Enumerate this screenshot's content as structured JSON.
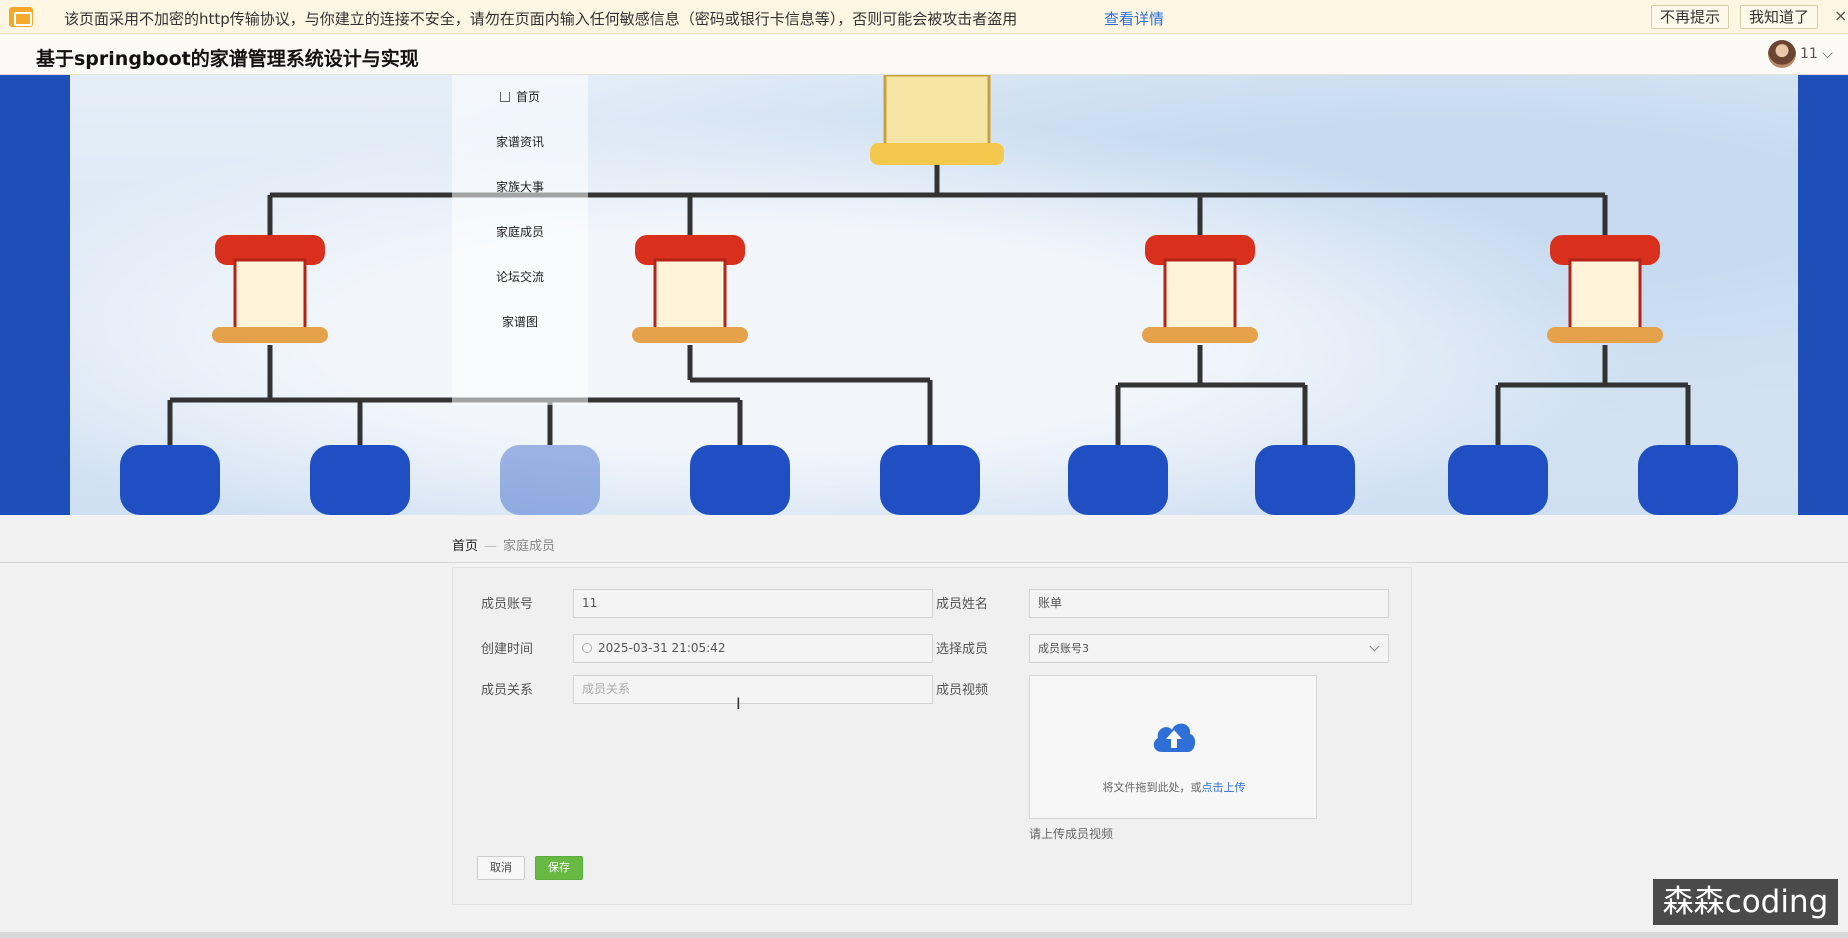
{
  "warning": {
    "text": "该页面采用不加密的http传输协议，与你建立的连接不安全，请勿在页面内输入任何敏感信息（密码或银行卡信息等），否则可能会被攻击者盗用",
    "link": "查看详情",
    "btn_no_remind": "不再提示",
    "btn_got_it": "我知道了",
    "close": "×"
  },
  "header": {
    "title": "基于springboot的家谱管理系统设计与实现",
    "user": "11 ⌵"
  },
  "menu": {
    "items": [
      "首页",
      "家谱资讯",
      "家族大事",
      "家庭成员",
      "论坛交流",
      "家谱图"
    ]
  },
  "breadcrumb": {
    "home": "首页",
    "separator": "—",
    "current": "家庭成员"
  },
  "form": {
    "account_label": "成员账号",
    "account_value": "11",
    "name_label": "成员姓名",
    "name_value": "账单",
    "created_label": "创建时间",
    "created_value": "2025-03-31 21:05:42",
    "select_label": "选择成员",
    "select_value": "成员账号3",
    "relation_label": "成员关系",
    "relation_placeholder": "成员关系",
    "video_label": "成员视频",
    "upload_text": "将文件拖到此处，或",
    "upload_link": "点击上传",
    "upload_tip": "请上传成员视频",
    "cancel": "取消",
    "save": "保存"
  },
  "watermark": "森森coding",
  "colors": {
    "save_green": "#67b944",
    "link_blue": "#2f6fd6",
    "upload_cloud": "#2e6fd8",
    "warning_bg": "#fcf6e3"
  }
}
